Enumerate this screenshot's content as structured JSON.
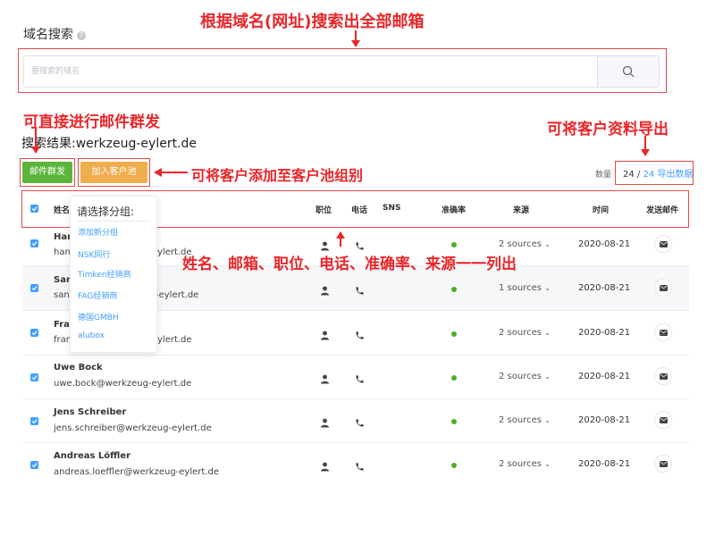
{
  "search": {
    "title": "域名搜索",
    "help_icon": "?",
    "placeholder": "要搜索的域名",
    "button_icon": "search-icon"
  },
  "result": {
    "label": "搜索结果:",
    "domain": "werkzeug-eylert.de"
  },
  "actions": {
    "mass_mail": "邮件群发",
    "add_to_pool": "加入客户池"
  },
  "count": {
    "label": "数量",
    "current": "24",
    "separator": "/",
    "total": "24",
    "export": "导出数据"
  },
  "table": {
    "headers": {
      "name": "姓名",
      "position": "职位",
      "phone": "电话",
      "sns": "SNS",
      "accuracy": "准确率",
      "source": "来源",
      "time": "时间",
      "send": "发送邮件"
    },
    "rows": [
      {
        "name": "Han",
        "email": "hann",
        "email_tail": "ylert.de",
        "source": "2 sources",
        "date": "2020-08-21"
      },
      {
        "name": "Sand",
        "email": "sand",
        "email_tail": "-eylert.de",
        "source": "1 sources",
        "date": "2020-08-21"
      },
      {
        "name": "Fran",
        "email": "fran",
        "email_tail": "ylert.de",
        "source": "2 sources",
        "date": "2020-08-21"
      },
      {
        "name": "Uwe Bock",
        "email": "uwe.bock@werkzeug-eylert.de",
        "email_tail": "",
        "source": "2 sources",
        "date": "2020-08-21"
      },
      {
        "name": "Jens Schreiber",
        "email": "jens.schreiber@werkzeug-eylert.de",
        "email_tail": "",
        "source": "2 sources",
        "date": "2020-08-21"
      },
      {
        "name": "Andreas Löffler",
        "email": "andreas.loeffler@werkzeug-eylert.de",
        "email_tail": "",
        "source": "2 sources",
        "date": "2020-08-21"
      }
    ]
  },
  "dropdown": {
    "title": "请选择分组:",
    "items": [
      "添加新分组",
      "NSK同行",
      "Timken经销商",
      "FAG经销商",
      "德国GMBH",
      "alubox"
    ]
  },
  "annotations": {
    "a1": "根据域名(网址)搜索出全部邮箱",
    "a2": "可直接进行邮件群发",
    "a3": "可将客户添加至客户池组别",
    "a4": "可将客户资料导出",
    "a5": "姓名、邮箱、职位、电话、准确率、来源一一列出"
  },
  "colors": {
    "annotation": "#e8262a",
    "mail_button": "#5bb53b",
    "pool_button": "#f0ad4e",
    "link": "#409eff",
    "accuracy_dot": "#4caf2a"
  }
}
